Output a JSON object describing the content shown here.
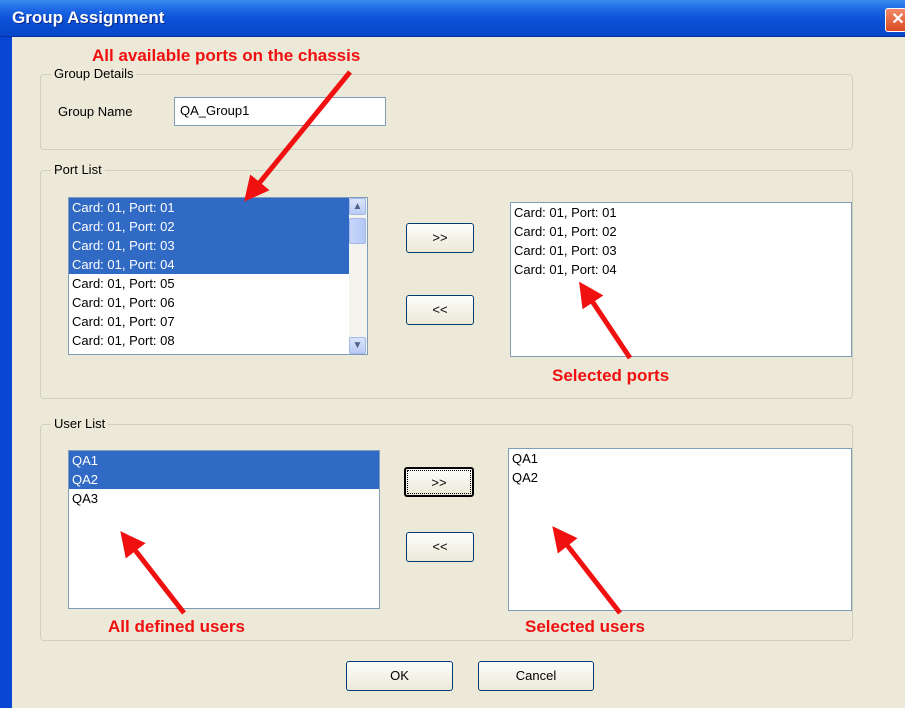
{
  "window": {
    "title": "Group Assignment",
    "close_glyph": "✕"
  },
  "group_details": {
    "legend": "Group Details",
    "name_label": "Group Name",
    "name_value": "QA_Group1"
  },
  "port_list": {
    "legend": "Port List",
    "available": [
      {
        "label": "Card: 01, Port: 01",
        "selected": true
      },
      {
        "label": "Card: 01, Port: 02",
        "selected": true
      },
      {
        "label": "Card: 01, Port: 03",
        "selected": true
      },
      {
        "label": "Card: 01, Port: 04",
        "selected": true
      },
      {
        "label": "Card: 01, Port: 05",
        "selected": false
      },
      {
        "label": "Card: 01, Port: 06",
        "selected": false
      },
      {
        "label": "Card: 01, Port: 07",
        "selected": false
      },
      {
        "label": "Card: 01, Port: 08",
        "selected": false
      }
    ],
    "selected": [
      "Card: 01, Port: 01",
      "Card: 01, Port: 02",
      "Card: 01, Port: 03",
      "Card: 01, Port: 04"
    ],
    "add_button": ">>",
    "remove_button": "<<"
  },
  "user_list": {
    "legend": "User List",
    "available": [
      {
        "label": "QA1",
        "selected": true
      },
      {
        "label": "QA2",
        "selected": true
      },
      {
        "label": "QA3",
        "selected": false
      }
    ],
    "selected": [
      "QA1",
      "QA2"
    ],
    "add_button": ">>",
    "remove_button": "<<"
  },
  "footer": {
    "ok_label": "OK",
    "cancel_label": "Cancel"
  },
  "annotations": {
    "available_ports": "All available ports on the chassis",
    "selected_ports": "Selected ports",
    "defined_users": "All defined users",
    "selected_users": "Selected users",
    "color": "#f01010"
  },
  "icons": {
    "scroll_up": "scroll-up-icon",
    "scroll_down": "scroll-down-icon",
    "close": "close-icon"
  }
}
